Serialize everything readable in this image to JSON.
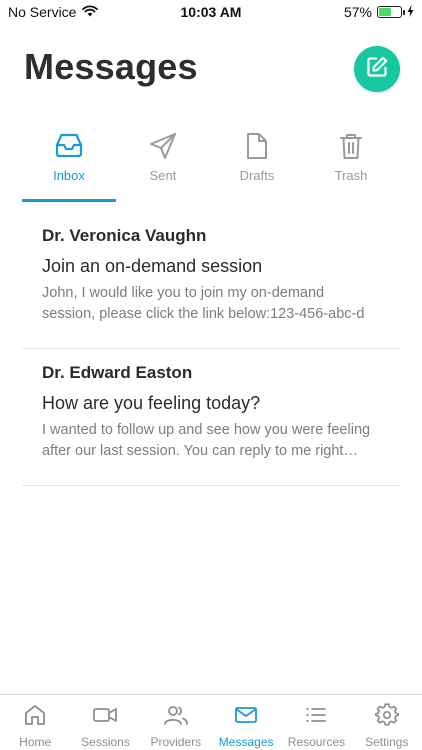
{
  "status": {
    "carrier": "No Service",
    "time": "10:03 AM",
    "battery_percent": "57%",
    "battery_level": 0.57
  },
  "header": {
    "title": "Messages",
    "compose_icon": "compose-icon",
    "accent_color": "#17c7a0"
  },
  "tabs": [
    {
      "label": "Inbox",
      "icon": "inbox-icon",
      "active": true
    },
    {
      "label": "Sent",
      "icon": "send-icon",
      "active": false
    },
    {
      "label": "Drafts",
      "icon": "document-icon",
      "active": false
    },
    {
      "label": "Trash",
      "icon": "trash-icon",
      "active": false
    }
  ],
  "messages": [
    {
      "sender": "Dr. Veronica Vaughn",
      "subject": "Join an on-demand session",
      "preview": "John, I would like you to join my on-demand session, please click the link below:123-456-abc-d"
    },
    {
      "sender": "Dr. Edward Easton",
      "subject": "How are you feeling today?",
      "preview": "I wanted to follow up and see how you were feeling after our last session. You can reply to me right here."
    }
  ],
  "bottom_nav": [
    {
      "label": "Home",
      "icon": "home-icon",
      "active": false
    },
    {
      "label": "Sessions",
      "icon": "video-camera-icon",
      "active": false
    },
    {
      "label": "Providers",
      "icon": "people-icon",
      "active": false
    },
    {
      "label": "Messages",
      "icon": "mail-icon",
      "active": true
    },
    {
      "label": "Resources",
      "icon": "list-icon",
      "active": false
    },
    {
      "label": "Settings",
      "icon": "gear-icon",
      "active": false
    }
  ],
  "colors": {
    "active": "#1a9ad6",
    "inactive": "#9a9a9a"
  }
}
